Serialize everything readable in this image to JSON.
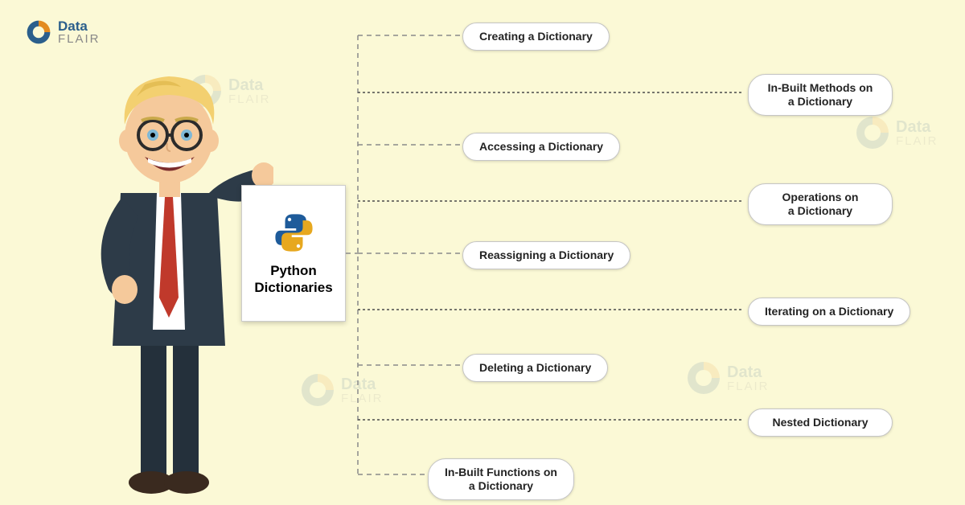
{
  "brand": {
    "top": "Data",
    "bottom": "FLAIR"
  },
  "card": {
    "title": "Python\nDictionaries"
  },
  "topics": {
    "creating": "Creating a Dictionary",
    "inbuilt_methods": "In-Built Methods on\na Dictionary",
    "accessing": "Accessing a Dictionary",
    "operations": "Operations on\na Dictionary",
    "reassigning": "Reassigning a Dictionary",
    "iterating": "Iterating on a Dictionary",
    "deleting": "Deleting a Dictionary",
    "nested": "Nested Dictionary",
    "inbuilt_functions": "In-Built Functions on\na Dictionary"
  },
  "colors": {
    "brand_blue": "#2b5f8c",
    "brand_orange": "#e38b1f",
    "bg": "#fbf9d6"
  }
}
